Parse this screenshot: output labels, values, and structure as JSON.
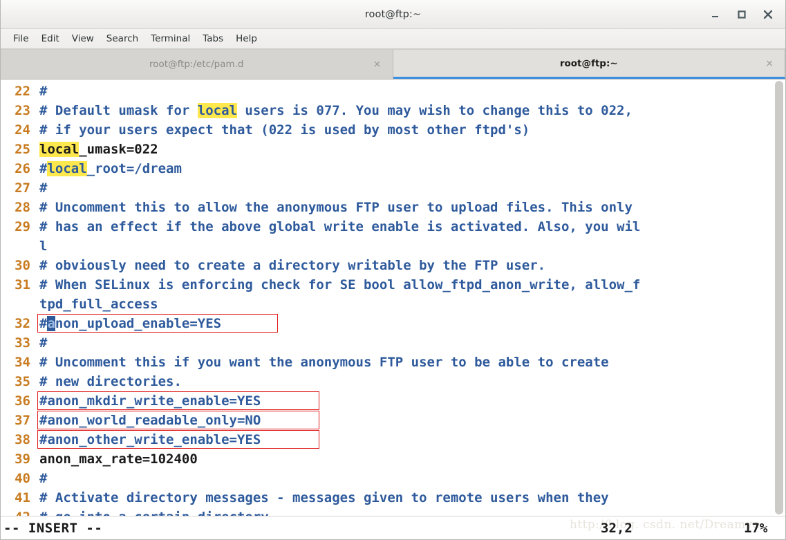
{
  "window": {
    "title": "root@ftp:~",
    "controls": {
      "minimize": "minimize-icon",
      "maximize": "maximize-icon",
      "close": "close-icon"
    }
  },
  "menubar": {
    "items": [
      {
        "label": "File"
      },
      {
        "label": "Edit"
      },
      {
        "label": "View"
      },
      {
        "label": "Search"
      },
      {
        "label": "Terminal"
      },
      {
        "label": "Tabs"
      },
      {
        "label": "Help"
      }
    ]
  },
  "tabs": [
    {
      "label": "root@ftp:/etc/pam.d",
      "active": false,
      "close": "×"
    },
    {
      "label": "root@ftp:~",
      "active": true,
      "close": "×"
    }
  ],
  "editor": {
    "highlight_term": "local",
    "highlight_color": "#ffe84d",
    "comment_color": "#2e5a9c",
    "linenumber_color": "#c87b1f",
    "plain_color": "#1a1a1a",
    "box_color": "#e01b1b",
    "cursor_char": "a",
    "lines": [
      {
        "num": "22",
        "text": "#"
      },
      {
        "num": "23",
        "pre": "# Default umask for ",
        "hl": "local",
        "post": " users is 077. You may wish to change this to 022,"
      },
      {
        "num": "24",
        "text": "# if your users expect that (022 is used by most other ftpd's)"
      },
      {
        "num": "25",
        "pre": "",
        "hl": "local",
        "post": "_umask=022",
        "plain": true
      },
      {
        "num": "26",
        "pre": "#",
        "hl": "local",
        "post": "_root=/dream"
      },
      {
        "num": "27",
        "text": "#"
      },
      {
        "num": "28",
        "text": "# Uncomment this to allow the anonymous FTP user to upload files. This only"
      },
      {
        "num": "29",
        "text": "# has an effect if the above global write enable is activated. Also, you wil"
      },
      {
        "num": "",
        "text": "l",
        "wrapped": true
      },
      {
        "num": "30",
        "text": "# obviously need to create a directory writable by the FTP user."
      },
      {
        "num": "31",
        "text": "# When SELinux is enforcing check for SE bool allow_ftpd_anon_write, allow_f"
      },
      {
        "num": "",
        "text": "tpd_full_access",
        "wrapped": true
      },
      {
        "num": "32",
        "cursor_pre": "#",
        "cursor": "a",
        "cursor_post": "non_upload_enable=YES",
        "boxed": "b32"
      },
      {
        "num": "33",
        "text": "#"
      },
      {
        "num": "34",
        "text": "# Uncomment this if you want the anonymous FTP user to be able to create"
      },
      {
        "num": "35",
        "text": "# new directories."
      },
      {
        "num": "36",
        "text": "#anon_mkdir_write_enable=YES",
        "boxed": "b36"
      },
      {
        "num": "37",
        "text": "#anon_world_readable_only=NO",
        "boxed": "b37"
      },
      {
        "num": "38",
        "text": "#anon_other_write_enable=YES",
        "boxed": "b38"
      },
      {
        "num": "39",
        "text": "anon_max_rate=102400",
        "plain": true
      },
      {
        "num": "40",
        "text": "#"
      },
      {
        "num": "41",
        "text": "# Activate directory messages - messages given to remote users when they"
      },
      {
        "num": "42",
        "text": "# go into a certain directory."
      }
    ]
  },
  "statusline": {
    "mode": "-- INSERT --",
    "position": "32,2",
    "percent": "17%",
    "watermark": "http://blog. csdn. net/Dreamya"
  }
}
